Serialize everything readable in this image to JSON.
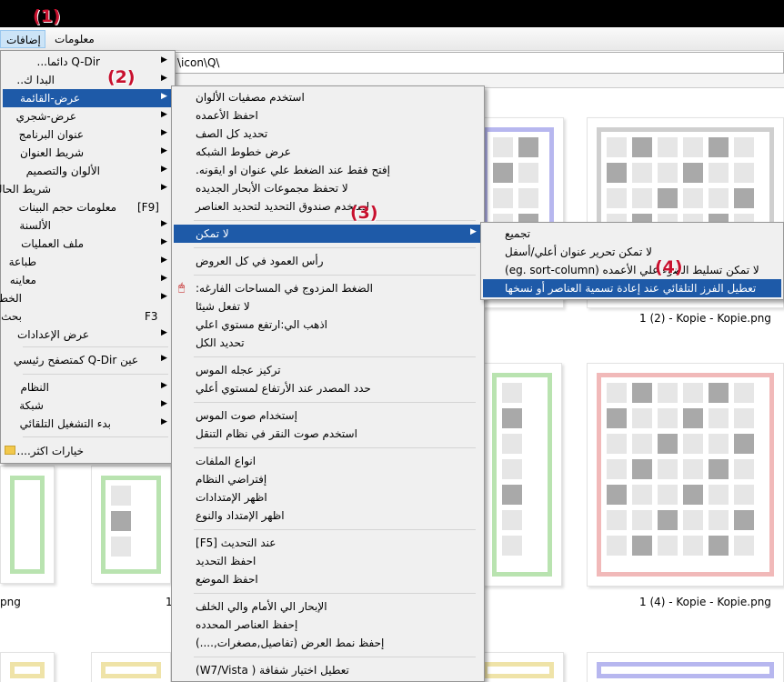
{
  "menubar": {
    "item1": "معلومات",
    "item2": "إضافات"
  },
  "address": "\\icon\\Q\\",
  "files": {
    "f1": "1 (2) - Kopie - Kopie.png",
    "f2": "1 (4) - Kopie - Kopie.png",
    "f3": "png",
    "f4": "1"
  },
  "annotations": {
    "a1": "(1)",
    "a2": "(2)",
    "a3": "(3)",
    "a4": "(4)"
  },
  "menu1": {
    "i0": "Q-Dir دائما...",
    "i1": "البدا ك..",
    "i2": "عرض-القائمة",
    "i3": "عرض-شجري",
    "i4": "عنوان البرنامج",
    "i5": "شريط العنوان",
    "i6": "الألوان والتصميم",
    "i7": "شريط الحاله",
    "i8": "معلومات حجم البينات",
    "i8sc": "[F9]",
    "i9": "الألسنة",
    "i10": "ملف العمليات",
    "i11": "طباعة",
    "i12": "معاينه",
    "i13": "الخط",
    "i14": "بحث",
    "i14sc": "F3",
    "i15": "عرض الإعدادات",
    "i16": "عين Q-Dir كمتصفح رئيسي",
    "i17": "النظام",
    "i18": "شبكة",
    "i19": "بدء التشغيل التلقائي",
    "i20": "خيارات اكثر...."
  },
  "menu2": {
    "i0": "استخدم مصفيات الألوان",
    "i1": "احفظ الأعمده",
    "i2": "تحديد كل الصف",
    "i3": "عرض خطوط الشبكه",
    "i4": "إفتح فقط عند الضغط علي عنوان او ايقونه.",
    "i5": "لا تحفظ مجموعات الأبحار الجديده",
    "i6": "استخدم صندوق التحديد لتحديد العناصر",
    "i7": "لا تمكن",
    "i8": "رأس العمود في كل العروض",
    "i9": "الضغط المزدوج في المساحات الفارغه:",
    "i10": "لا تفعل شيئا",
    "i11": "اذهب الي:ارتفع مستوي اعلي",
    "i12": "تحديد الكل",
    "i13": "تركيز عجله الموس",
    "i14": "حدد المصدر عند الأرتفاع لمستوي أعلي",
    "i15": "إستخدام صوت الموس",
    "i16": "استخدم صوت النقر في نظام التنقل",
    "i17": "انواع الملفات",
    "i18": "إفتراضي النظام",
    "i19": "اظهر الإمتدادات",
    "i20": "اظهر الإمتداد والنوع",
    "i21": "عند التحديث [F5]",
    "i22": "احفظ التحديد",
    "i23": "احفظ الموضع",
    "i24": "الإبحار الي الأمام والي الخلف",
    "i25": "إحفظ العناصر المحدده",
    "i26": "إحفظ نمط العرض (تفاصيل,مصغرات,....)",
    "i27": "تعطيل اختيار شفافة ( W7/Vista)"
  },
  "menu3": {
    "i0": "تجميع",
    "i1": "لا تمكن تحرير عنوان أعلي/أسفل",
    "i2": "لا تمكن تسليط الضوء علي الأعمده (eg. sort-column)",
    "i3": "تعطيل الفرز التلقائي عند إعادة تسمية العناصر أو نسخها"
  }
}
